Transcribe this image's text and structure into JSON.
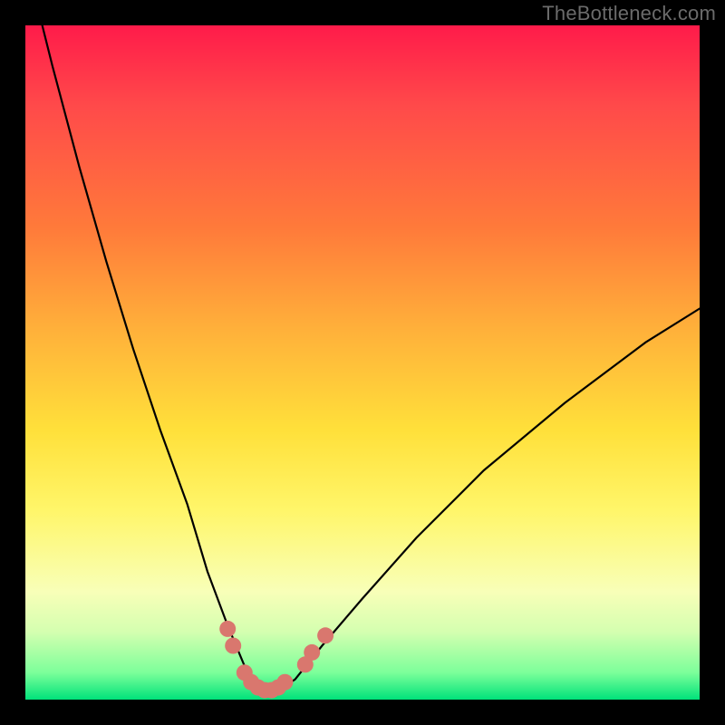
{
  "watermark": "TheBottleneck.com",
  "chart_data": {
    "type": "line",
    "title": "",
    "xlabel": "",
    "ylabel": "",
    "xlim": [
      0,
      100
    ],
    "ylim": [
      0,
      100
    ],
    "series": [
      {
        "name": "bottleneck-curve",
        "x": [
          0,
          4,
          8,
          12,
          16,
          20,
          24,
          27,
          30,
          32.5,
          35,
          37,
          40,
          44,
          50,
          58,
          68,
          80,
          92,
          100
        ],
        "values": [
          110,
          94,
          79,
          65,
          52,
          40,
          29,
          19,
          11,
          5,
          1,
          1,
          3,
          8,
          15,
          24,
          34,
          44,
          53,
          58
        ]
      }
    ],
    "markers": [
      {
        "name": "left-cluster-1",
        "x": 30.0,
        "y": 10.5
      },
      {
        "name": "left-cluster-2",
        "x": 30.8,
        "y": 8.0
      },
      {
        "name": "flat-1",
        "x": 32.5,
        "y": 4.0
      },
      {
        "name": "flat-2",
        "x": 33.5,
        "y": 2.6
      },
      {
        "name": "flat-3",
        "x": 34.5,
        "y": 1.8
      },
      {
        "name": "flat-4",
        "x": 35.5,
        "y": 1.4
      },
      {
        "name": "flat-5",
        "x": 36.5,
        "y": 1.4
      },
      {
        "name": "flat-6",
        "x": 37.5,
        "y": 1.8
      },
      {
        "name": "flat-7",
        "x": 38.5,
        "y": 2.6
      },
      {
        "name": "right-cluster-1",
        "x": 41.5,
        "y": 5.2
      },
      {
        "name": "right-cluster-2",
        "x": 42.5,
        "y": 7.0
      },
      {
        "name": "right-cluster-3",
        "x": 44.5,
        "y": 9.5
      }
    ],
    "marker_style": {
      "color": "#d9776e",
      "radius_px": 9
    },
    "gradient_stops": [
      {
        "pos": 0.0,
        "color": "#ff1b4a"
      },
      {
        "pos": 0.3,
        "color": "#ff7a3a"
      },
      {
        "pos": 0.6,
        "color": "#ffe03a"
      },
      {
        "pos": 0.84,
        "color": "#f8ffb8"
      },
      {
        "pos": 1.0,
        "color": "#00e27a"
      }
    ]
  }
}
